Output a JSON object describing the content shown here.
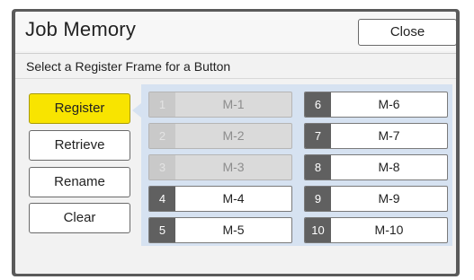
{
  "dialog": {
    "title": "Job Memory",
    "close_label": "Close",
    "instruction": "Select a Register Frame for a Button"
  },
  "actions": [
    {
      "label": "Register",
      "active": true
    },
    {
      "label": "Retrieve",
      "active": false
    },
    {
      "label": "Rename",
      "active": false
    },
    {
      "label": "Clear",
      "active": false
    }
  ],
  "slots": [
    {
      "num": "1",
      "label": "M-1",
      "enabled": false
    },
    {
      "num": "2",
      "label": "M-2",
      "enabled": false
    },
    {
      "num": "3",
      "label": "M-3",
      "enabled": false
    },
    {
      "num": "4",
      "label": "M-4",
      "enabled": true
    },
    {
      "num": "5",
      "label": "M-5",
      "enabled": true
    },
    {
      "num": "6",
      "label": "M-6",
      "enabled": true
    },
    {
      "num": "7",
      "label": "M-7",
      "enabled": true
    },
    {
      "num": "8",
      "label": "M-8",
      "enabled": true
    },
    {
      "num": "9",
      "label": "M-9",
      "enabled": true
    },
    {
      "num": "10",
      "label": "M-10",
      "enabled": true
    }
  ],
  "colors": {
    "active_button": "#f8e400",
    "slot_area": "#d6e2f1",
    "number_tab": "#606060"
  }
}
